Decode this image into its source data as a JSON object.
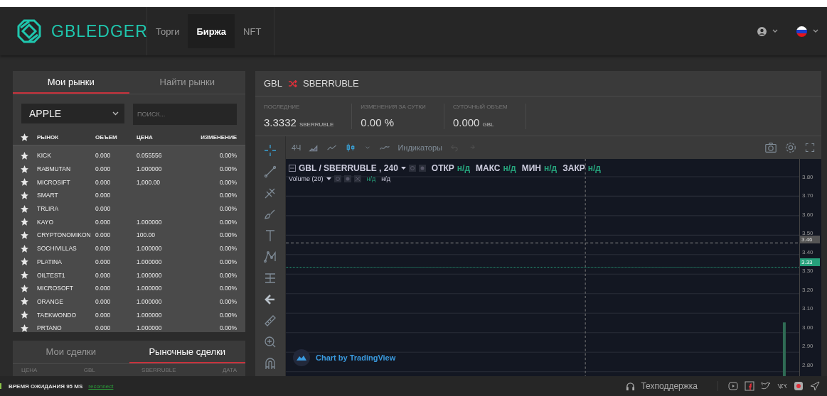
{
  "header": {
    "logo": "GBLEDGER",
    "nav": [
      {
        "label": "Торги",
        "selected": false
      },
      {
        "label": "Биржа",
        "selected": true
      },
      {
        "label": "NFT",
        "selected": false
      }
    ]
  },
  "markets": {
    "tabs": [
      {
        "label": "Мои рынки",
        "selected": true
      },
      {
        "label": "Найти рынки",
        "selected": false
      }
    ],
    "select": "APPLE",
    "search_placeholder": "ПОИСК...",
    "columns": [
      "РЫНОК",
      "ОБЪЕМ",
      "ЦЕНА",
      "ИЗМЕНЕНИЕ"
    ],
    "rows": [
      {
        "market": "KICK",
        "volume": "0.000",
        "price": "0.055556",
        "change": "0.00%"
      },
      {
        "market": "RABMUTAN",
        "volume": "0.000",
        "price": "1.000000",
        "change": "0.00%"
      },
      {
        "market": "MICROSIFT",
        "volume": "0.000",
        "price": "1,000.00",
        "change": "0.00%"
      },
      {
        "market": "SMART",
        "volume": "0.000",
        "price": "",
        "change": "0.00%"
      },
      {
        "market": "TRLIRA",
        "volume": "0.000",
        "price": "",
        "change": "0.00%"
      },
      {
        "market": "KAYO",
        "volume": "0.000",
        "price": "1.000000",
        "change": "0.00%"
      },
      {
        "market": "CRYPTONOMIKON",
        "volume": "0.000",
        "price": "100.00",
        "change": "0.00%"
      },
      {
        "market": "SOCHIVILLAS",
        "volume": "0.000",
        "price": "1.000000",
        "change": "0.00%"
      },
      {
        "market": "PLATINA",
        "volume": "0.000",
        "price": "1.000000",
        "change": "0.00%"
      },
      {
        "market": "OILTEST1",
        "volume": "0.000",
        "price": "1.000000",
        "change": "0.00%"
      },
      {
        "market": "MICROSOFT",
        "volume": "0.000",
        "price": "1.000000",
        "change": "0.00%"
      },
      {
        "market": "ORANGE",
        "volume": "0.000",
        "price": "1.000000",
        "change": "0.00%"
      },
      {
        "market": "TAEKWONDO",
        "volume": "0.000",
        "price": "1.000000",
        "change": "0.00%"
      },
      {
        "market": "PRTANO",
        "volume": "0.000",
        "price": "1.000000",
        "change": "0.00%"
      }
    ]
  },
  "trades": {
    "tabs": [
      {
        "label": "Мои сделки",
        "selected": false
      },
      {
        "label": "Рыночные сделки",
        "selected": true
      }
    ],
    "columns": [
      "ЦЕНА",
      "GBL",
      "SBERRUBLE",
      "ДАТА"
    ]
  },
  "pair": {
    "base": "GBL",
    "quote": "SBERRUBLE"
  },
  "stats": [
    {
      "label": "ПОСЛЕДНИЕ",
      "value": "3.3332",
      "unit": "SBERRUBLE"
    },
    {
      "label": "ИЗМЕНЕНИЯ ЗА СУТКИ",
      "value": "0.00 %"
    },
    {
      "label": "СУТОЧНЫЙ ОБЪЕМ",
      "value": "0.000",
      "unit": "GBL"
    }
  ],
  "chart": {
    "interval": "4Ч",
    "indicators": "Индикаторы",
    "legend": {
      "symbol": "GBL / SBERRUBLE , 240",
      "fields": [
        {
          "label": "ОТКР",
          "value": "н/д"
        },
        {
          "label": "МАКС",
          "value": "н/д"
        },
        {
          "label": "МИН",
          "value": "н/д"
        },
        {
          "label": "ЗАКР",
          "value": "н/д"
        }
      ]
    },
    "volume": {
      "label": "Volume (20)",
      "values": [
        "н/д",
        "н/д"
      ]
    },
    "attribution": "Chart by TradingView",
    "axis": [
      "3.80",
      "3.70",
      "3.60",
      "3.50",
      "3.40",
      "3.30",
      "3.20",
      "3.10",
      "3.00",
      "2.90",
      "2.80"
    ],
    "crosshair_price": "3.46",
    "last_price": "3.33"
  },
  "footer": {
    "latency": "ВРЕМЯ ОЖИДАНИЯ 95 MS",
    "reconnect": "reconnect",
    "support": "Техподдержка"
  }
}
